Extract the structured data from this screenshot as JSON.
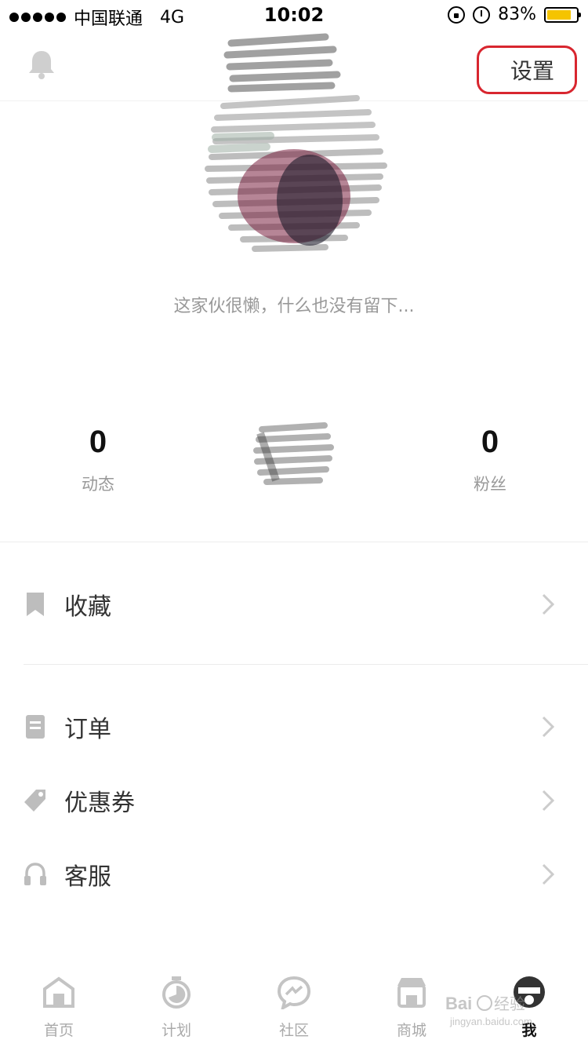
{
  "status_bar": {
    "carrier": "中国联通",
    "network": "4G",
    "time": "10:02",
    "battery": "83%",
    "battery_level": 0.83,
    "battery_color": "#f5c400"
  },
  "header": {
    "bell_icon": "bell-icon",
    "settings_label": "设置",
    "highlight_color": "#d8262f"
  },
  "profile": {
    "bio": "这家伙很懒，什么也没有留下...",
    "stats": [
      {
        "value": "0",
        "label": "动态"
      },
      {
        "value": "0",
        "label": "粉丝"
      }
    ]
  },
  "menu": [
    {
      "label": "收藏",
      "icon": "bookmark-icon"
    },
    {
      "label": "订单",
      "icon": "receipt-icon"
    },
    {
      "label": "优惠券",
      "icon": "tag-icon"
    },
    {
      "label": "客服",
      "icon": "headphones-icon"
    }
  ],
  "tabs": [
    {
      "label": "首页",
      "icon": "home-icon"
    },
    {
      "label": "计划",
      "icon": "timer-icon"
    },
    {
      "label": "社区",
      "icon": "chat-icon"
    },
    {
      "label": "商城",
      "icon": "shop-icon"
    },
    {
      "label": "我",
      "icon": "profile-icon",
      "active": true
    }
  ],
  "watermark": {
    "brand": "Baidu经验",
    "url": "jingyan.baidu.com"
  }
}
